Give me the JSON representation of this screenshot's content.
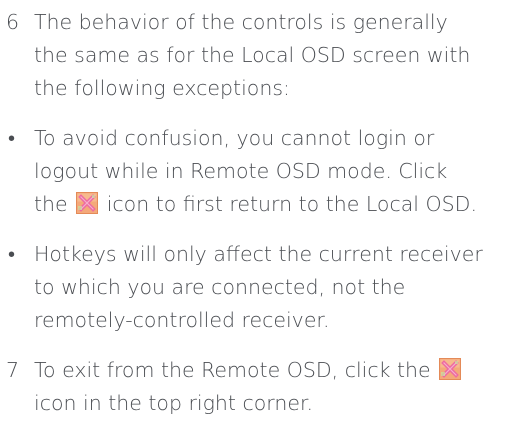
{
  "step6": {
    "number": "6",
    "lines": [
      "The behavior of the controls is generally",
      "the same as for the Local OSD screen with",
      "the following exceptions:"
    ]
  },
  "bullet1": {
    "symbol": "•",
    "line1": "To avoid confusion, you cannot login or",
    "line2": "logout while in Remote OSD mode. Click",
    "line3_before": "the",
    "line3_after": "icon to first return to the Local OSD."
  },
  "bullet2": {
    "symbol": "•",
    "lines": [
      "Hotkeys will only affect the current receiver",
      "to which you are connected, not the",
      "remotely-controlled receiver."
    ]
  },
  "step7": {
    "number": "7",
    "line1_before": "To exit from the Remote OSD, click the",
    "line2": "icon in the top right corner."
  },
  "icons": {
    "close": "close-x-icon",
    "colors": {
      "bg": "#f4a97a",
      "x": "#ee6aa0",
      "highlight": "#c8e6a0"
    }
  }
}
